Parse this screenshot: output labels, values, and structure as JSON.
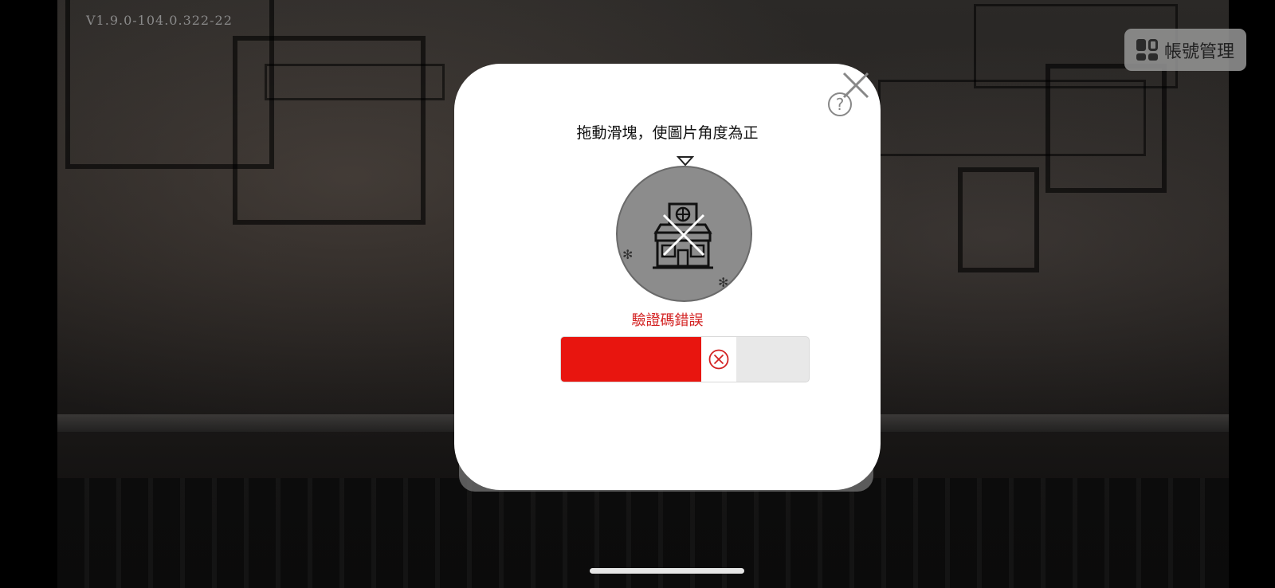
{
  "version": "V1.9.0-104.0.322-22",
  "account_button": {
    "label": "帳號管理",
    "icon": "grid-icon"
  },
  "captcha": {
    "instruction": "拖動滑塊，使圖片角度為正",
    "error_message": "驗證碼錯誤",
    "help_label": "?",
    "close_icon": "close-icon",
    "slider": {
      "progress": 0.66,
      "state": "error",
      "handle_icon": "error-x-circle-icon"
    }
  },
  "colors": {
    "error": "#d32222",
    "slider_fill": "#e8150f",
    "modal_bg": "#ffffff",
    "image_bg": "#8c8c8c"
  }
}
